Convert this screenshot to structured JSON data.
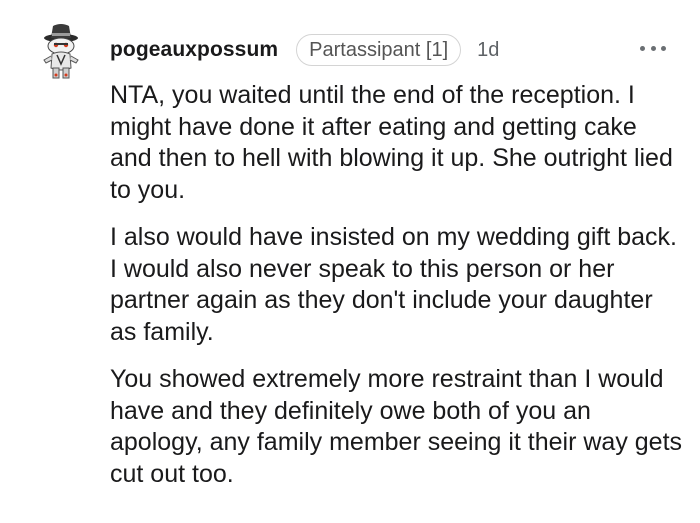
{
  "comment": {
    "username": "pogeauxpossum",
    "flair": "Partassipant [1]",
    "age": "1d",
    "avatar_icon": "snoo-avatar-fedora-icon",
    "more_icon": "more-options-icon",
    "paragraphs": [
      "NTA, you waited until the end of the reception. I might have done it after eating and getting cake and then to hell with blowing it up. She outright lied to you.",
      "I also would have insisted on my wedding gift back. I would also never speak to this person or her partner again as they don't include your daughter as family.",
      "You showed extremely more restraint than I would have and they definitely owe both of you an apology, any family member seeing it their way gets cut out too."
    ]
  }
}
